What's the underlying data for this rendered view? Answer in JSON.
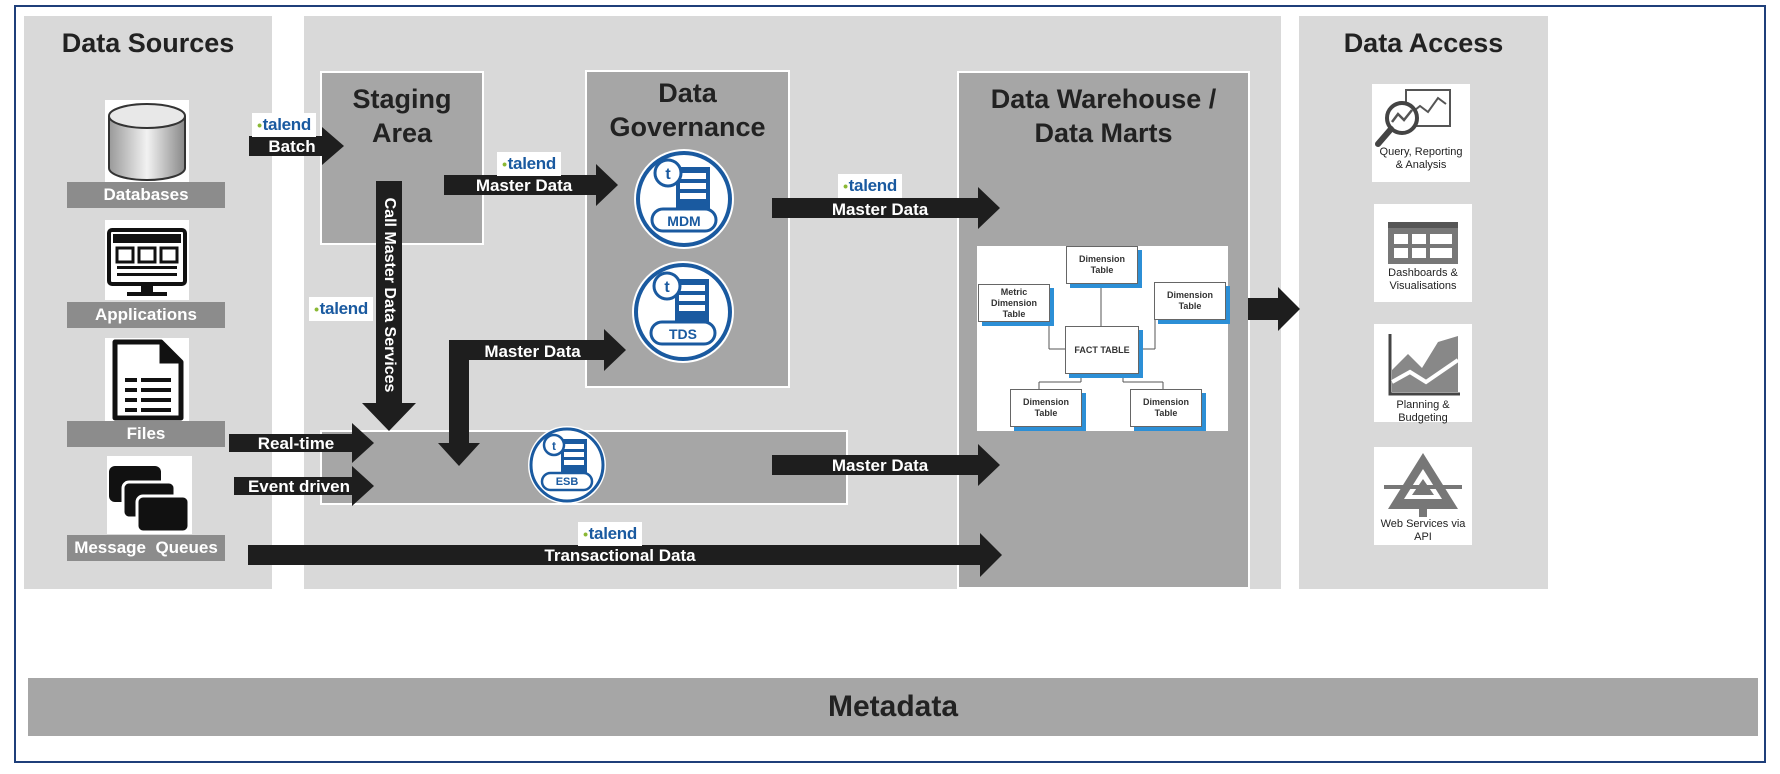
{
  "data_sources": {
    "title": "Data Sources",
    "items": [
      {
        "label": "Databases",
        "icon": "database-icon"
      },
      {
        "label": "Applications",
        "icon": "monitor-icon"
      },
      {
        "label": "Files",
        "icon": "document-icon"
      },
      {
        "label": "Message  Queues",
        "icon": "message-queue-icon"
      }
    ]
  },
  "staging": {
    "title_line1": "Staging",
    "title_line2": "Area"
  },
  "governance": {
    "title_line1": "Data",
    "title_line2": "Governance",
    "mdm_label": "MDM",
    "tds_label": "TDS"
  },
  "esb_label": "ESB",
  "warehouse": {
    "title_line1": "Data Warehouse /",
    "title_line2": "Data Marts",
    "schema": {
      "fact": "FACT TABLE",
      "dim_top": "Dimension Table",
      "dim_left_line1": "Metric",
      "dim_left_line2": "Dimension Table",
      "dim_right": "Dimension Table",
      "dim_bottom_left": "Dimension Table",
      "dim_bottom_right": "Dimension Table"
    }
  },
  "data_access": {
    "title": "Data Access",
    "items": [
      {
        "label_line1": "Query, Reporting",
        "label_line2": "& Analysis",
        "icon": "query-analysis-icon"
      },
      {
        "label_line1": "Dashboards &",
        "label_line2": "Visualisations",
        "icon": "dashboard-icon"
      },
      {
        "label_line1": "Planning & Budgeting",
        "label_line2": "",
        "icon": "planning-chart-icon"
      },
      {
        "label_line1": "Web Services via API",
        "label_line2": "",
        "icon": "web-services-icon"
      }
    ]
  },
  "arrows": {
    "batch": "Batch",
    "master_data_1": "Master Data",
    "master_data_2": "Master Data",
    "master_data_3": "Master Data",
    "master_data_4": "Master Data",
    "call_master": "Call Master Data Services",
    "real_time": "Real-time",
    "event_driven": "Event driven",
    "transactional": "Transactional Data"
  },
  "brand": "talend",
  "metadata": "Metadata",
  "colors": {
    "panel": "#d9d9d9",
    "box": "#a6a6a6",
    "arrow": "#1e1e1e",
    "accent_blue": "#1a5aa0",
    "frame": "#1f3f7a"
  }
}
